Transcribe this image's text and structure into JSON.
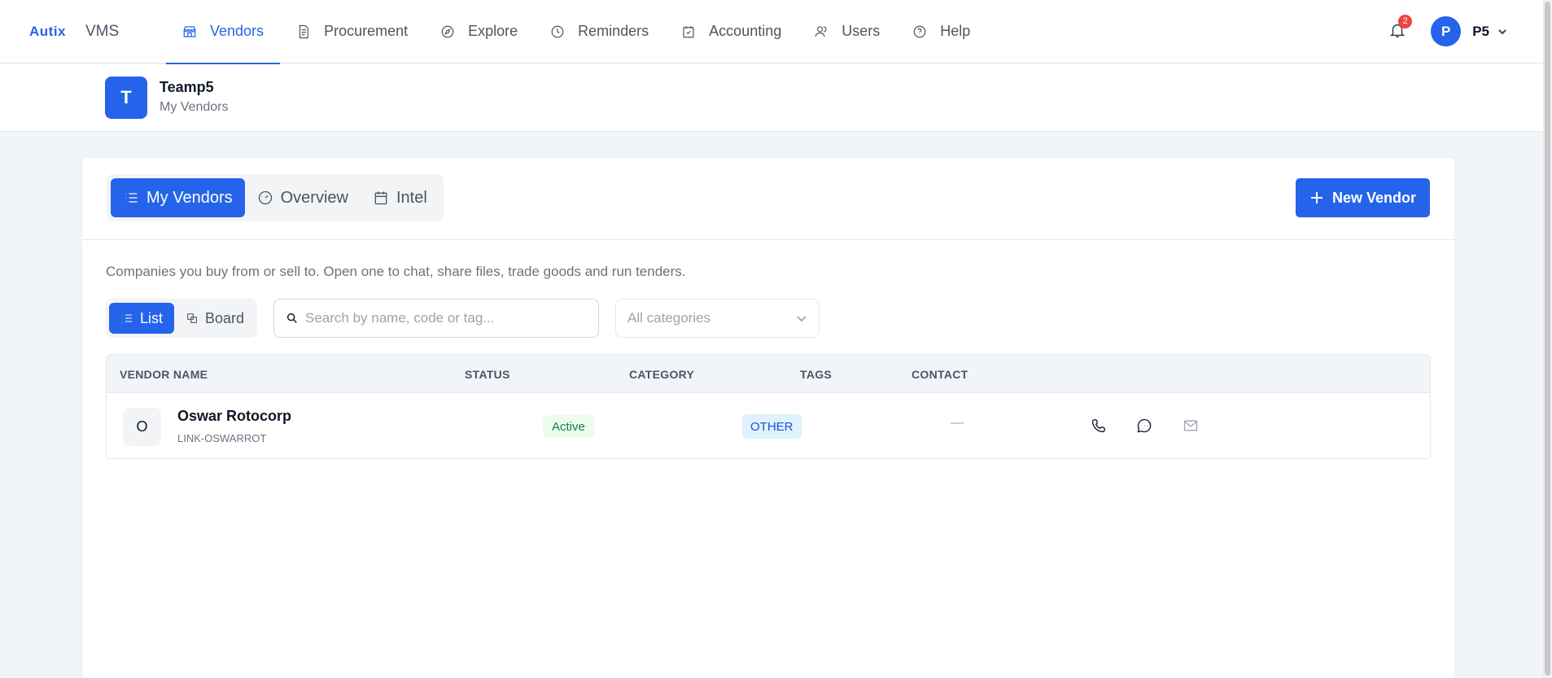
{
  "brand": {
    "logo": "Autix",
    "product": "VMS"
  },
  "nav": [
    {
      "label": "Vendors",
      "icon": "store-icon",
      "active": true
    },
    {
      "label": "Procurement",
      "icon": "document-icon"
    },
    {
      "label": "Explore",
      "icon": "compass-icon"
    },
    {
      "label": "Reminders",
      "icon": "clock-icon"
    },
    {
      "label": "Accounting",
      "icon": "calendar-check-icon"
    },
    {
      "label": "Users",
      "icon": "users-icon"
    },
    {
      "label": "Help",
      "icon": "help-circle-icon"
    }
  ],
  "notifications": {
    "count": "2"
  },
  "user": {
    "initial": "P",
    "name": "P5"
  },
  "team": {
    "initial": "T",
    "name": "Teamp5",
    "subtitle": "My Vendors"
  },
  "tabs": [
    {
      "label": "My Vendors",
      "icon": "list-icon",
      "active": true
    },
    {
      "label": "Overview",
      "icon": "gauge-icon"
    },
    {
      "label": "Intel",
      "icon": "calendar-icon"
    }
  ],
  "new_vendor_label": "New Vendor",
  "description": "Companies you buy from or sell to. Open one to chat, share files, trade goods and run tenders.",
  "view_toggle": {
    "list": "List",
    "board": "Board"
  },
  "search": {
    "placeholder": "Search by name, code or tag...",
    "value": ""
  },
  "category_filter": {
    "selected": "All categories"
  },
  "table": {
    "headers": {
      "vendor_name": "VENDOR NAME",
      "status": "STATUS",
      "category": "CATEGORY",
      "tags": "TAGS",
      "contact": "CONTACT"
    },
    "rows": [
      {
        "initial": "O",
        "name": "Oswar Rotocorp",
        "code": "LINK-OSWARROT",
        "status": "Active",
        "category": "OTHER",
        "tags": "—"
      }
    ]
  },
  "colors": {
    "accent": "#2563eb",
    "status_active_bg": "#ecfdf0",
    "status_active_fg": "#15803d",
    "category_bg": "#e0f2fe",
    "badge_red": "#ef4444"
  }
}
